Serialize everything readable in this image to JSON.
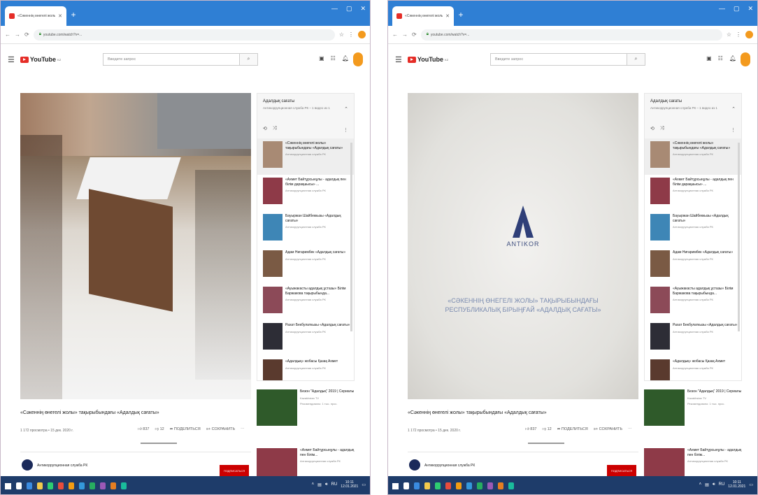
{
  "screenshots": [
    {
      "tab_title": "«Сәкеннің өнегелі жолы» ...",
      "url": "youtube.com/watch?v=...",
      "search_placeholder": "Введите запрос",
      "logo_text": "YouTube",
      "logo_suffix": "KZ",
      "player_mode": "photo",
      "playlist": {
        "title": "Адалдық сағаты",
        "subtitle": "Антикоррупционная служба РК – 1 видео из 1",
        "items": [
          {
            "title": "«Сәкеннің өнегелі жолы» тақырыбындағы «Адалдық сағаты»",
            "channel": "Антикоррупционная служба РК",
            "thumb": "#a88a74",
            "current": true
          },
          {
            "title": "«Ахмет Байтұрсынұлы - адалдық пен білім дарақшысы» ...",
            "channel": "Антикоррупционная служба РК",
            "thumb": "#8e3a48",
            "current": false
          },
          {
            "title": "Бауыржан Шайбеккызы «Адалдық сағаты»",
            "channel": "Антикоррупционная служба РК",
            "thumb": "#3e86b6",
            "current": false
          },
          {
            "title": "Адам Нигаримбек «Адалдық сағаты»",
            "channel": "Антикоррупционная служба РК",
            "thumb": "#7a5a44",
            "current": false
          },
          {
            "title": "«Ауыжакасты адалдық ұстазы» Білім Баржакова тақырыбында...",
            "channel": "Антикоррупционная служба РК",
            "thumb": "#8c4a58",
            "current": false
          },
          {
            "title": "Рахат Бекбулаткызы «Адалдық сағаты»",
            "channel": "Антикоррупционная служба РК",
            "thumb": "#2d2d36",
            "current": false
          },
          {
            "title": "«Адалдық» жобасы Қазақ Ахмет",
            "channel": "Антикоррупционная служба РК",
            "thumb": "#5a3a2e",
            "current": false
          }
        ]
      },
      "recommendations": [
        {
          "title": "Безон \"Адалдық\" 2019 | Сериалы",
          "channel": "Kazakhstan TV",
          "meta": "Рекомендовано: 1 тыс. прос.",
          "thumb": "#2f5a2a"
        },
        {
          "title": "«Ахмет Байтұрсынұлы - адалдық пен білім...",
          "channel": "Антикоррупционная служба РК",
          "meta": "",
          "thumb": "#8e3a48"
        }
      ],
      "video_title": "«Сәкеннің өнегелі жолы» тақырыбындағы «Адалдық сағаты»",
      "video_meta": "1 172 просмотра • 15 дек. 2020 г.",
      "likes": "837",
      "dislikes": "12",
      "share": "ПОДЕЛИТЬСЯ",
      "save": "СОХРАНИТЬ",
      "channel_name": "Антикоррупционная служба РК",
      "subscribe": "ПОДПИСАТЬСЯ",
      "antikor": {
        "brand": "ANTIKOR",
        "caption": "«СӘКЕННІҢ ӨНЕГЕЛІ ЖОЛЫ» ТАҚЫРЫБЫНДАҒЫ РЕСПУБЛИКАЛЫҚ БІРЫҢҒАЙ «АДАЛДЫҚ САҒАТЫ»"
      },
      "clock": {
        "time": "10:11",
        "date": "12.01.2021"
      }
    },
    {
      "tab_title": "«Сәкеннің өнегелі жолы» ...",
      "url": "youtube.com/watch?v=...",
      "search_placeholder": "Введите запрос",
      "logo_text": "YouTube",
      "logo_suffix": "KZ",
      "player_mode": "antikor",
      "playlist": {
        "title": "Адалдық сағаты",
        "subtitle": "Антикоррупционная служба РК – 1 видео из 1",
        "items": [
          {
            "title": "«Сәкеннің өнегелі жолы» тақырыбындағы «Адалдық сағаты»",
            "channel": "Антикоррупционная служба РК",
            "thumb": "#a88a74",
            "current": true
          },
          {
            "title": "«Ахмет Байтұрсынұлы - адалдық пен білім дарақшысы» ...",
            "channel": "Антикоррупционная служба РК",
            "thumb": "#8e3a48",
            "current": false
          },
          {
            "title": "Бауыржан Шайбеккызы «Адалдық сағаты»",
            "channel": "Антикоррупционная служба РК",
            "thumb": "#3e86b6",
            "current": false
          },
          {
            "title": "Адам Нигаримбек «Адалдық сағаты»",
            "channel": "Антикоррупционная служба РК",
            "thumb": "#7a5a44",
            "current": false
          },
          {
            "title": "«Ауыжакасты адалдық ұстазы» Білім Баржакова тақырыбында...",
            "channel": "Антикоррупционная служба РК",
            "thumb": "#8c4a58",
            "current": false
          },
          {
            "title": "Рахат Бекбулаткызы «Адалдық сағаты»",
            "channel": "Антикоррупционная служба РК",
            "thumb": "#2d2d36",
            "current": false
          },
          {
            "title": "«Адалдық» жобасы Қазақ Ахмет",
            "channel": "Антикоррупционная служба РК",
            "thumb": "#5a3a2e",
            "current": false
          }
        ]
      },
      "recommendations": [
        {
          "title": "Безон \"Адалдық\" 2019 | Сериалы",
          "channel": "Kazakhstan TV",
          "meta": "Рекомендовано: 1 тыс. прос.",
          "thumb": "#2f5a2a"
        },
        {
          "title": "«Ахмет Байтұрсынұлы - адалдық пен білім...",
          "channel": "Антикоррупционная служба РК",
          "meta": "",
          "thumb": "#8e3a48"
        }
      ],
      "video_title": "«Сәкеннің өнегелі жолы» тақырыбындағы «Адалдық сағаты»",
      "video_meta": "1 172 просмотра • 15 дек. 2020 г.",
      "likes": "837",
      "dislikes": "12",
      "share": "ПОДЕЛИТЬСЯ",
      "save": "СОХРАНИТЬ",
      "channel_name": "Антикоррупционная служба РК",
      "subscribe": "ПОДПИСАТЬСЯ",
      "antikor": {
        "brand": "ANTIKOR",
        "caption": "«СӘКЕННІҢ ӨНЕГЕЛІ ЖОЛЫ» ТАҚЫРЫБЫНДАҒЫ РЕСПУБЛИКАЛЫҚ БІРЫҢҒАЙ «АДАЛДЫҚ САҒАТЫ»"
      },
      "clock": {
        "time": "10:11",
        "date": "12.01.2021"
      }
    }
  ],
  "taskbar_icons": [
    "#ffffff",
    "#3a8be0",
    "#f2c94c",
    "#2ecc71",
    "#e74c3c",
    "#f39c12",
    "#3498db",
    "#27ae60",
    "#9b59b6",
    "#e67e22",
    "#1abc9c"
  ]
}
